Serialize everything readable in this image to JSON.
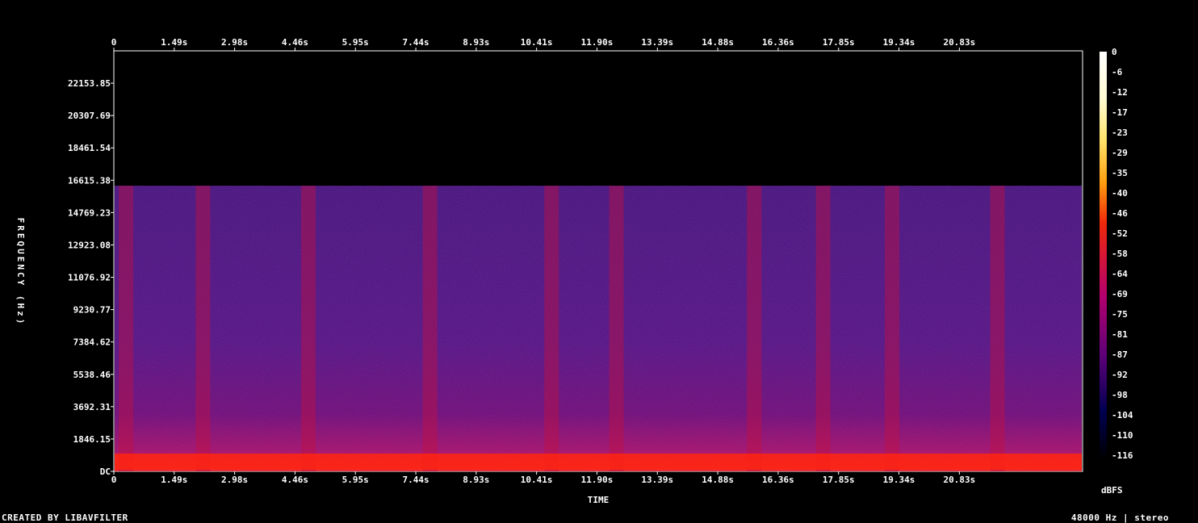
{
  "chart_data": {
    "type": "heatmap",
    "subtype": "spectrogram",
    "xlabel": "TIME",
    "ylabel": "FREQUENCY (Hz)",
    "x_ticks": [
      "0",
      "1.49s",
      "2.98s",
      "4.46s",
      "5.95s",
      "7.44s",
      "8.93s",
      "10.41s",
      "11.90s",
      "13.39s",
      "14.88s",
      "16.36s",
      "17.85s",
      "19.34s",
      "20.83s"
    ],
    "y_ticks": [
      "DC",
      "1846.15",
      "3692.31",
      "5538.46",
      "7384.62",
      "9230.77",
      "11076.92",
      "12923.08",
      "14769.23",
      "16615.38",
      "18461.54",
      "20307.69",
      "22153.85"
    ],
    "y_range_hz": [
      0,
      24000
    ],
    "colorbar": {
      "unit": "dBFS",
      "ticks": [
        "0",
        "-6",
        "-12",
        "-17",
        "-23",
        "-29",
        "-35",
        "-40",
        "-46",
        "-52",
        "-58",
        "-64",
        "-69",
        "-75",
        "-81",
        "-87",
        "-92",
        "-98",
        "-104",
        "-110",
        "-116"
      ],
      "colors": [
        "#ffffff",
        "#fffbd0",
        "#ffe168",
        "#ff9e10",
        "#f0280a",
        "#b4006e",
        "#5a0078",
        "#000050",
        "#000000"
      ]
    },
    "content_cutoff_hz": 16300,
    "loud_time_bands_s": [
      0.3,
      2.2,
      4.8,
      7.8,
      10.8,
      12.4,
      15.8,
      17.5,
      19.2,
      21.8
    ],
    "background_color": "#000000"
  },
  "footer": {
    "left": "CREATED BY LIBAVFILTER",
    "right": "48000 Hz | stereo"
  }
}
